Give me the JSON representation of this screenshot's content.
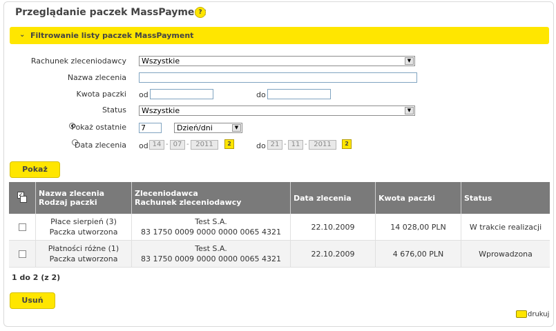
{
  "page": {
    "title": "Przeglądanie paczek MassPayment",
    "help_glyph": "?"
  },
  "filter": {
    "header_label": "Filtrowanie listy paczek MassPayment",
    "chevron": "chevron-down-icon",
    "fields": {
      "account_label": "Rachunek zleceniodawcy",
      "account_value": "Wszystkie",
      "name_label": "Nazwa zlecenia",
      "name_value": "",
      "amount_label": "Kwota paczki",
      "amount_from_label": "od",
      "amount_from_value": "",
      "amount_to_label": "do",
      "amount_to_value": "",
      "status_label": "Status",
      "status_value": "Wszystkie",
      "show_last_label": "Pokaż ostatnie",
      "show_last_value": "7",
      "show_last_unit": "Dzień/dni",
      "date_label": "Data zlecenia",
      "date_from_label": "od",
      "date_from": {
        "day": "14",
        "month": "07",
        "year": "2011"
      },
      "date_to_label": "do",
      "date_to": {
        "day": "21",
        "month": "11",
        "year": "2011"
      },
      "calendar_glyph": "2",
      "date_sep": "-"
    },
    "show_button": "Pokaż"
  },
  "table": {
    "headers": {
      "col2_line1": "Nazwa zlecenia",
      "col2_line2": "Rodzaj paczki",
      "col3_line1": "Zleceniodawca",
      "col3_line2": "Rachunek zleceniodawcy",
      "col4": "Data zlecenia",
      "col5": "Kwota paczki",
      "col6": "Status"
    },
    "rows": [
      {
        "name": "Płace sierpień (3)",
        "type": "Paczka utworzona",
        "payer": "Test S.A.",
        "account": "83 1750 0009 0000 0000 0065 4321",
        "date": "22.10.2009",
        "amount": "14 028,00 PLN",
        "status": "W trakcie realizacji"
      },
      {
        "name": "Płatności różne (1)",
        "type": "Paczka utworzona",
        "payer": "Test S.A.",
        "account": "83 1750 0009 0000 0000 0065 4321",
        "date": "22.10.2009",
        "amount": "4 676,00 PLN",
        "status": "Wprowadzona"
      }
    ]
  },
  "pager": "1 do 2 (z 2)",
  "delete_button": "Usuń",
  "print_label": "drukuj",
  "colors": {
    "accent": "#ffe600",
    "table_header": "#7a7a7a"
  }
}
